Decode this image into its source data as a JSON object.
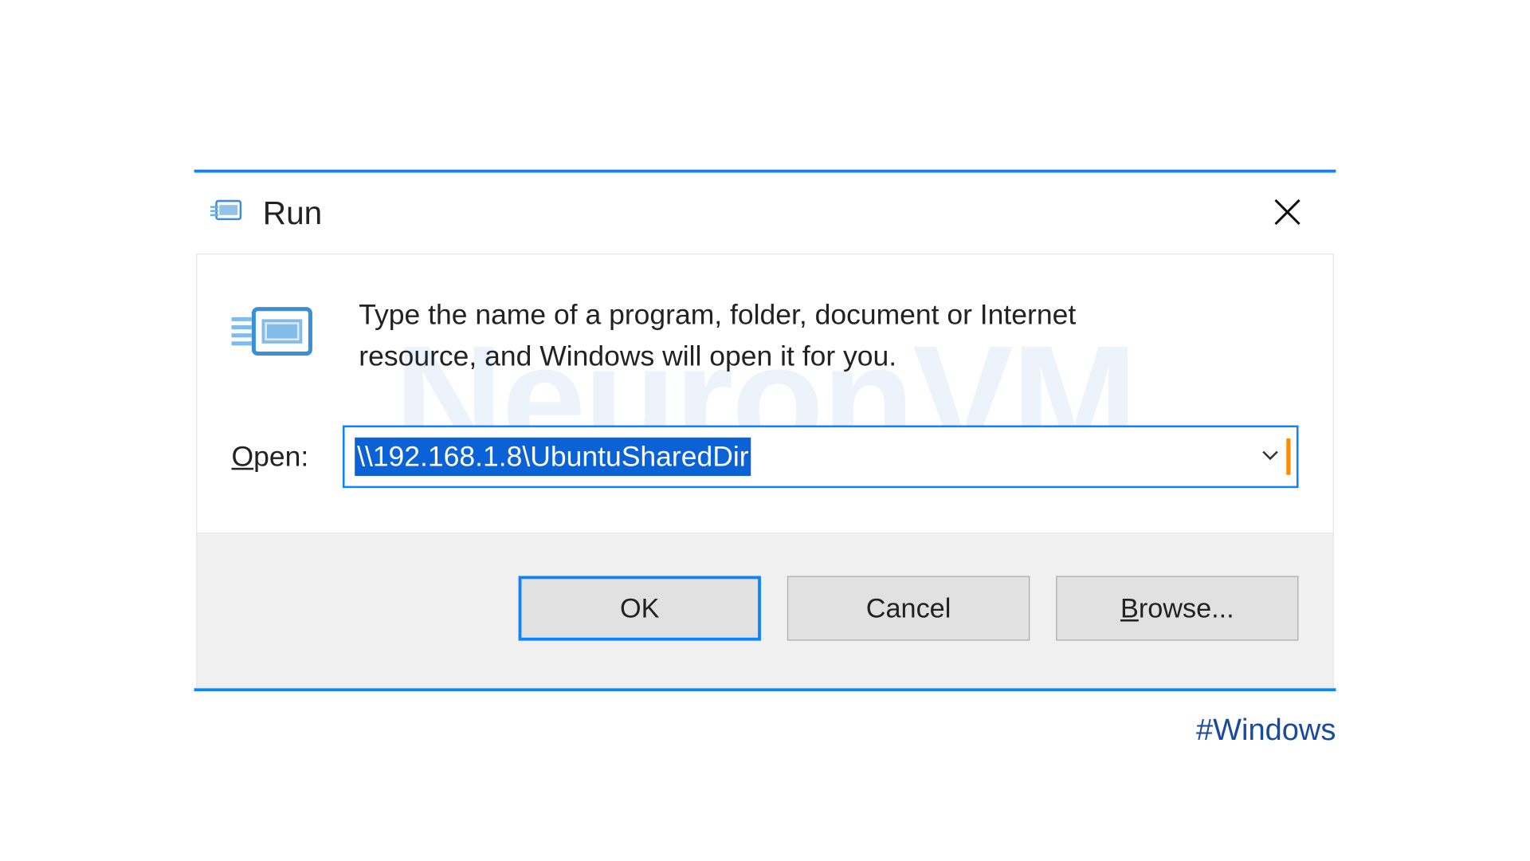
{
  "dialog": {
    "title": "Run",
    "description": "Type the name of a program, folder, document or Internet resource, and Windows will open it for you.",
    "open_label": "Open:",
    "open_value": "\\\\192.168.1.8\\UbuntuSharedDir",
    "buttons": {
      "ok": "OK",
      "cancel": "Cancel",
      "browse": "Browse..."
    }
  },
  "watermark": "NeuronVM",
  "hashtag": "#Windows"
}
